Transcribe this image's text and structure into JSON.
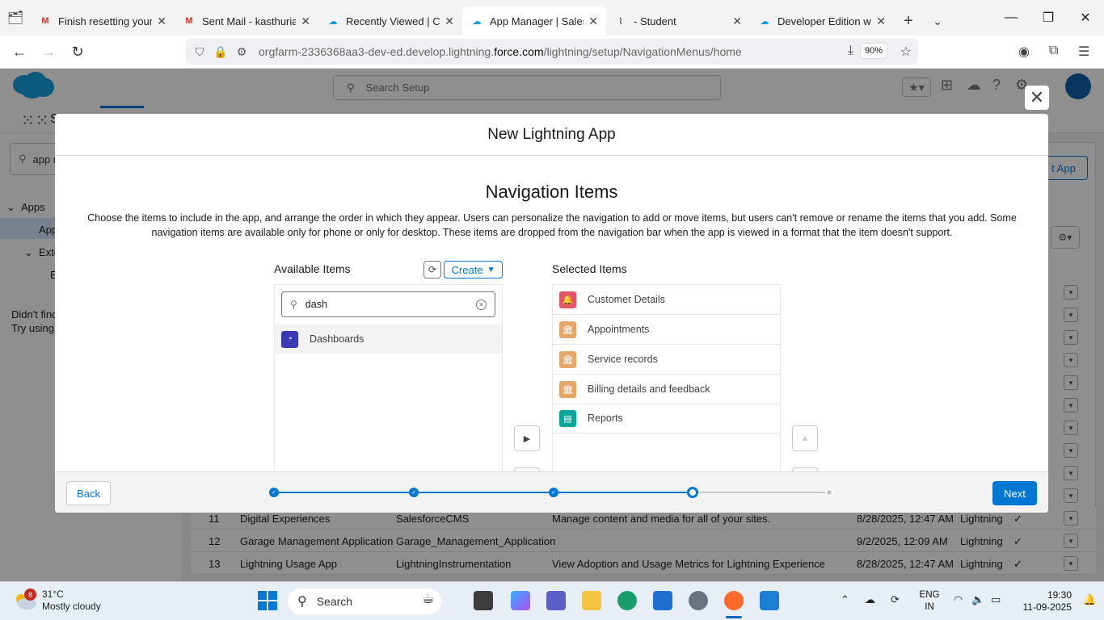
{
  "browser": {
    "tabs": [
      {
        "title": "Finish resetting your Sa",
        "favicon": "gmail-icon"
      },
      {
        "title": "Sent Mail - kasthurianu",
        "favicon": "gmail-icon"
      },
      {
        "title": "Recently Viewed | Custo",
        "favicon": "salesforce-icon"
      },
      {
        "title": "App Manager | Salesfor",
        "favicon": "salesforce-icon"
      },
      {
        "title": "- Student",
        "favicon": "chart-icon"
      },
      {
        "title": "Developer Edition with",
        "favicon": "salesforce-icon"
      }
    ],
    "url_prefix": "orgfarm-2336368aa3-dev-ed.develop.lightning.",
    "url_domain": "force.com",
    "url_path": "/lightning/setup/NavigationMenus/home",
    "zoom": "90%"
  },
  "salesforce": {
    "search_placeholder": "Search Setup",
    "subheader_partial": "S"
  },
  "sidebar": {
    "quickfind_value": "app m",
    "items": [
      "Apps",
      "App",
      "Exte",
      "E"
    ],
    "not_found_1": "Didn't find",
    "not_found_2": "Try using G"
  },
  "background": {
    "new_app_label": "t App",
    "rows": [
      {
        "num": "11",
        "name": "Digital Experiences",
        "dev_name": "SalesforceCMS",
        "description": "Manage content and media for all of your sites.",
        "modified": "8/28/2025, 12:47 AM",
        "type": "Lightning"
      },
      {
        "num": "12",
        "name": "Garage Management Application",
        "dev_name": "Garage_Management_Application",
        "description": "",
        "modified": "9/2/2025, 12:09 AM",
        "type": "Lightning"
      },
      {
        "num": "13",
        "name": "Lightning Usage App",
        "dev_name": "LightningInstrumentation",
        "description": "View Adoption and Usage Metrics for Lightning Experience",
        "modified": "8/28/2025, 12:47 AM",
        "type": "Lightning"
      }
    ],
    "check_glyph": "✓"
  },
  "modal": {
    "title": "New Lightning App",
    "step_title": "Navigation Items",
    "step_description": "Choose the items to include in the app, and arrange the order in which they appear. Users can personalize the navigation to add or move items, but users can't remove or rename the items that you add. Some navigation items are available only for phone or only for desktop. These items are dropped from the navigation bar when the app is viewed in a format that the item doesn't support.",
    "available_label": "Available Items",
    "create_label": "Create",
    "search_value": "dash",
    "available_items": [
      {
        "label": "Dashboards",
        "icon": "dashboard-icon",
        "color": "#3a3bb4"
      }
    ],
    "selected_label": "Selected Items",
    "selected_items": [
      {
        "label": "Customer Details",
        "icon": "bell-icon",
        "color": "#e3566a"
      },
      {
        "label": "Appointments",
        "icon": "bank-icon",
        "color": "#e3a86a"
      },
      {
        "label": "Service records",
        "icon": "bank-icon",
        "color": "#e3a86a"
      },
      {
        "label": "Billing details and feedback",
        "icon": "bank-icon",
        "color": "#e3a86a"
      },
      {
        "label": "Reports",
        "icon": "report-icon",
        "color": "#06a59a"
      }
    ],
    "back_label": "Back",
    "next_label": "Next",
    "progress": {
      "total_steps": 5,
      "current_step": 4
    }
  },
  "taskbar": {
    "weather_temp": "31°C",
    "weather_desc": "Mostly cloudy",
    "weather_badge": "8",
    "search_label": "Search",
    "lang_1": "ENG",
    "lang_2": "IN",
    "time": "19:30",
    "date": "11-09-2025"
  },
  "colors": {
    "brand": "#0176d3",
    "salesforce_cloud": "#0d9dda"
  }
}
